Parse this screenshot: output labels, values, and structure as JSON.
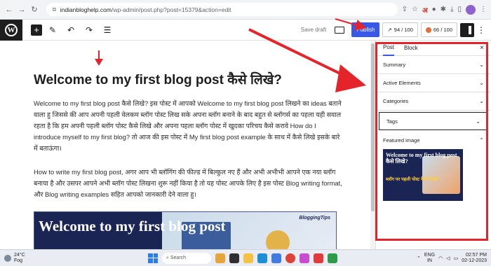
{
  "browser": {
    "url_domain": "indianbloghelp.com",
    "url_path": "/wp-admin/post.php?post=15379&action=edit",
    "ext_label": "अ"
  },
  "editor": {
    "save_draft": "Save draft",
    "publish": "Publish",
    "seo_score": "94 / 100",
    "readability_score": "66 / 100",
    "accent": "#3858e9"
  },
  "post": {
    "title": "Welcome to my first blog post कैसे लिखे?",
    "paragraph1": "Welcome to my first blog post कैसे लिखे? इस पोस्ट में आपको Welcome to my first blog post लिखने का ideas बताने वाला हु जिससे की आप अपनी पहली वेलकम ब्लॉग पोस्ट लिख सके अपना ब्लॉग बनाने के बाद बहुत से ब्लॉगर्स का पहला यही सवाल रहता है कि हम अपनी पहली ब्लॉग पोस्ट कैसे लिखे और अपना पहला ब्लॉग पोस्ट में खुदका परिचय कैसे करावे How do I introduce myself to my first blog? तो आज की इस पोस्ट में My first blog post example के साथ में कैसे लिखे इसके बारे में बताऊंगा।",
    "paragraph2": "How to write my first blog post, अगर आप भी ब्लॉगिंग की फील्ड में बिल्कुल नए हैं और अभी अभीभी आपने एक नया ब्लॉग बनाया है और उसपर आपने अभी ब्लॉग पोस्ट लिखना शुरू नहीं किया है तो यह पोस्ट आपके लिए है इस पोस्ट Blog writing format, और Blog writing examples सहित आपको जानकारी देने वाला हु।",
    "image_text": "Welcome to my first blog post",
    "image_brand": "BloggingTips"
  },
  "sidebar": {
    "tabs": [
      "Post",
      "Block"
    ],
    "close": "×",
    "panels": [
      "Summary",
      "Active Elements",
      "Categories",
      "Tags"
    ],
    "featured_label": "Featured image",
    "thumb_text1": "Welcome to my first blog post कैसे लिखे?",
    "thumb_text2": "ब्लॉग पर पहली पोस्ट कैसे लिखें?"
  },
  "taskbar": {
    "temp": "24°C",
    "weather": "Fog",
    "search": "Search",
    "lang1": "ENG",
    "lang2": "IN",
    "time": "02:57 PM",
    "date": "02-12-2023"
  }
}
